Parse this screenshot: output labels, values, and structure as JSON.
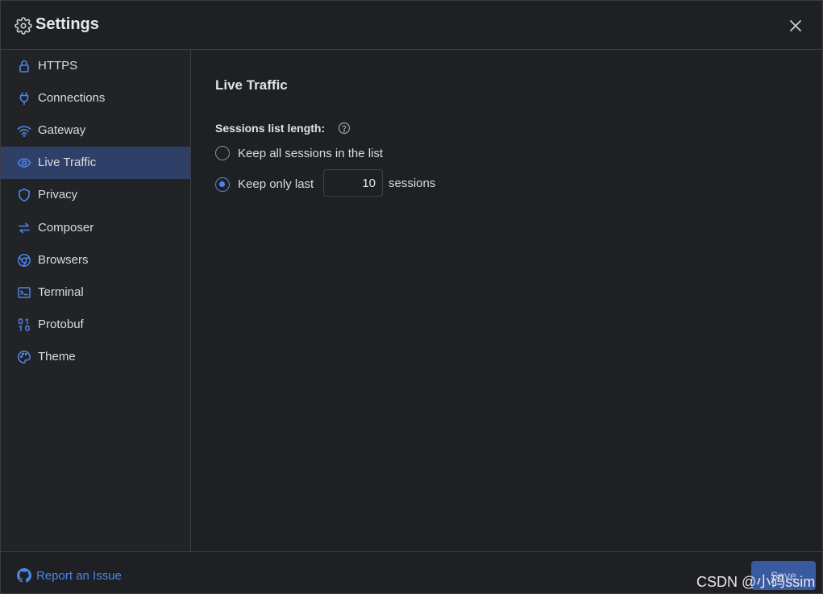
{
  "header": {
    "title": "Settings",
    "icon": "gear-icon",
    "close_icon": "close-icon"
  },
  "sidebar": {
    "items": [
      {
        "label": "HTTPS",
        "icon": "lock-icon",
        "active": false
      },
      {
        "label": "Connections",
        "icon": "plug-icon",
        "active": false
      },
      {
        "label": "Gateway",
        "icon": "wifi-icon",
        "active": false
      },
      {
        "label": "Live Traffic",
        "icon": "eye-icon",
        "active": true
      },
      {
        "label": "Privacy",
        "icon": "shield-icon",
        "active": false
      },
      {
        "label": "Composer",
        "icon": "arrows-swap-icon",
        "active": false
      },
      {
        "label": "Browsers",
        "icon": "chrome-icon",
        "active": false
      },
      {
        "label": "Terminal",
        "icon": "terminal-icon",
        "active": false
      },
      {
        "label": "Protobuf",
        "icon": "binary-icon",
        "active": false
      },
      {
        "label": "Theme",
        "icon": "palette-icon",
        "active": false
      }
    ]
  },
  "main": {
    "section_title": "Live Traffic",
    "sessions_label": "Sessions list length:",
    "option_all": "Keep all sessions in the list",
    "option_last": "Keep only last",
    "selected_option": "last",
    "count_value": "10",
    "sessions_suffix": "sessions"
  },
  "footer": {
    "report_label": "Report an Issue",
    "save_label": "Save",
    "watermark": "CSDN @小码ssim"
  },
  "colors": {
    "accent": "#4d86e6",
    "active_bg": "#2e4068",
    "background": "#1f2024",
    "border": "#3a3c42"
  }
}
